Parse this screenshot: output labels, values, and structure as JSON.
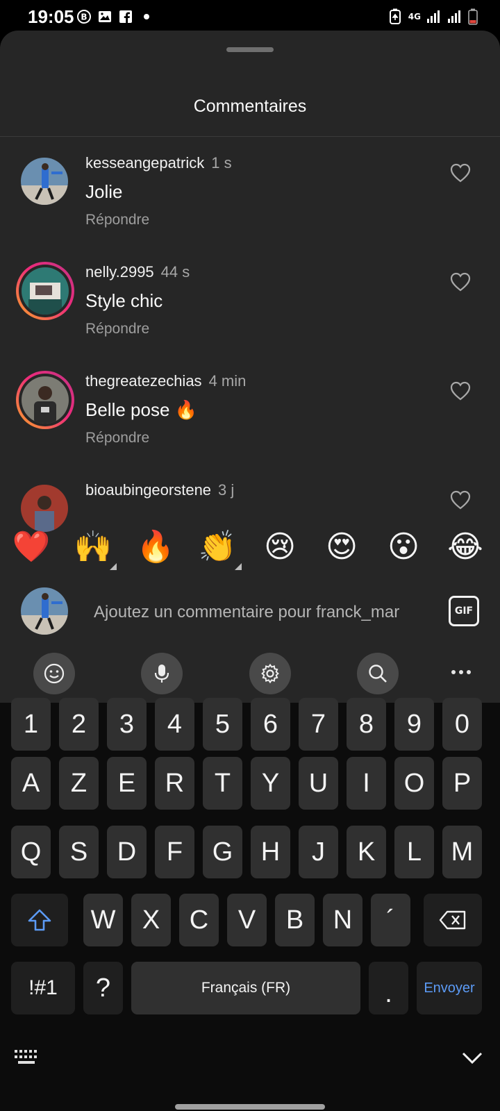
{
  "status_bar": {
    "time": "19:05",
    "network": "4G"
  },
  "sheet": {
    "title": "Commentaires"
  },
  "comments": [
    {
      "username": "kesseangepatrick",
      "time": "1 s",
      "text": "Jolie",
      "reply_label": "Répondre"
    },
    {
      "username": "nelly.2995",
      "time": "44 s",
      "text": "Style chic",
      "reply_label": "Répondre"
    },
    {
      "username": "thegreatezechias",
      "time": "4 min",
      "text": "Belle pose 🔥",
      "reply_label": "Répondre"
    },
    {
      "username": "bioaubingeorstene",
      "time": "3 j",
      "text": "",
      "reply_label": ""
    }
  ],
  "emoji_bar": [
    "❤️",
    "🙌",
    "🔥",
    "👏",
    "😢",
    "😍",
    "😮",
    "😂"
  ],
  "composer": {
    "placeholder": "Ajoutez un commentaire pour franck_mar",
    "gif_label": "GIF"
  },
  "keyboard": {
    "rows": [
      [
        "1",
        "2",
        "3",
        "4",
        "5",
        "6",
        "7",
        "8",
        "9",
        "0"
      ],
      [
        "A",
        "Z",
        "E",
        "R",
        "T",
        "Y",
        "U",
        "I",
        "O",
        "P"
      ],
      [
        "Q",
        "S",
        "D",
        "F",
        "G",
        "H",
        "J",
        "K",
        "L",
        "M"
      ],
      [
        "W",
        "X",
        "C",
        "V",
        "B",
        "N",
        "´"
      ]
    ],
    "symbols_label": "!#1",
    "question_label": "?",
    "space_label": "Français (FR)",
    "period_label": ".",
    "send_label": "Envoyer"
  },
  "colors": {
    "sheet_bg": "#262626",
    "keyboard_bg": "#0c0c0c",
    "key_bg": "#303030",
    "send_text": "#5c9bf6",
    "story_ring_start": "#f9a826",
    "story_ring_end": "#c13584"
  }
}
